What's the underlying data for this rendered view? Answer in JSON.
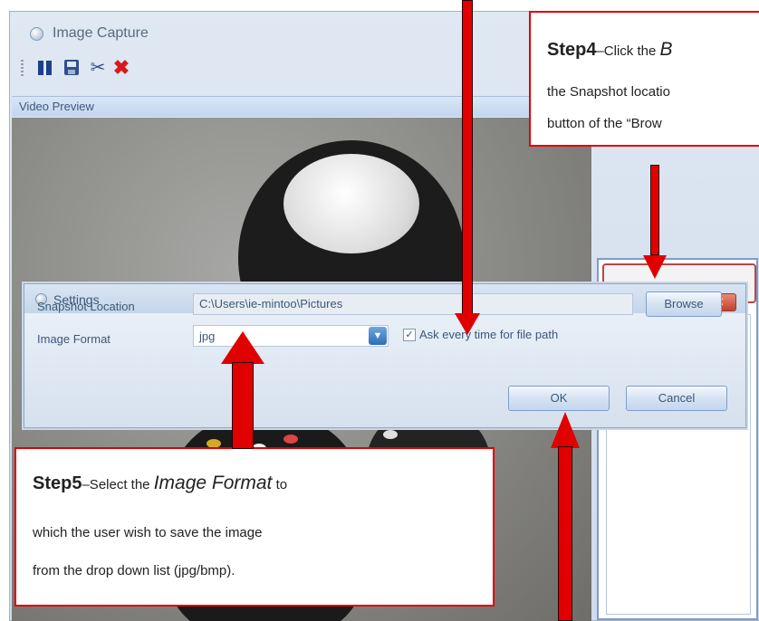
{
  "window": {
    "title": "Image Capture"
  },
  "toolbar": {
    "pause": "pause-icon",
    "save": "save-icon",
    "tools": "tools-icon",
    "close": "close-icon"
  },
  "video_preview": {
    "label": "Video Preview"
  },
  "settings": {
    "title": "Settings",
    "snapshot_label": "Snapshot Location",
    "snapshot_value": "C:\\Users\\ie-mintoo\\Pictures",
    "browse": "Browse",
    "format_label": "Image Format",
    "format_value": "jpg",
    "ask_label": "Ask every time for file path",
    "ask_checked": true,
    "ok": "OK",
    "cancel": "Cancel",
    "close": "✕"
  },
  "callouts": {
    "step4": {
      "title": "Step4",
      "line1_prefix": "–Click the ",
      "line1_italic": "B",
      "line2": "the Snapshot locatio",
      "line3": "button of the “Brow"
    },
    "step5": {
      "title": "Step5",
      "line1_prefix": "–Select the ",
      "line1_italic": "Image Format",
      "line1_suffix": " to",
      "line2": "which the user wish to save the image",
      "line3": "from the drop down list (jpg/bmp)."
    }
  },
  "colors": {
    "arrow": "#e00000",
    "callout_border": "#e00000",
    "accent": "#2f6db8"
  }
}
